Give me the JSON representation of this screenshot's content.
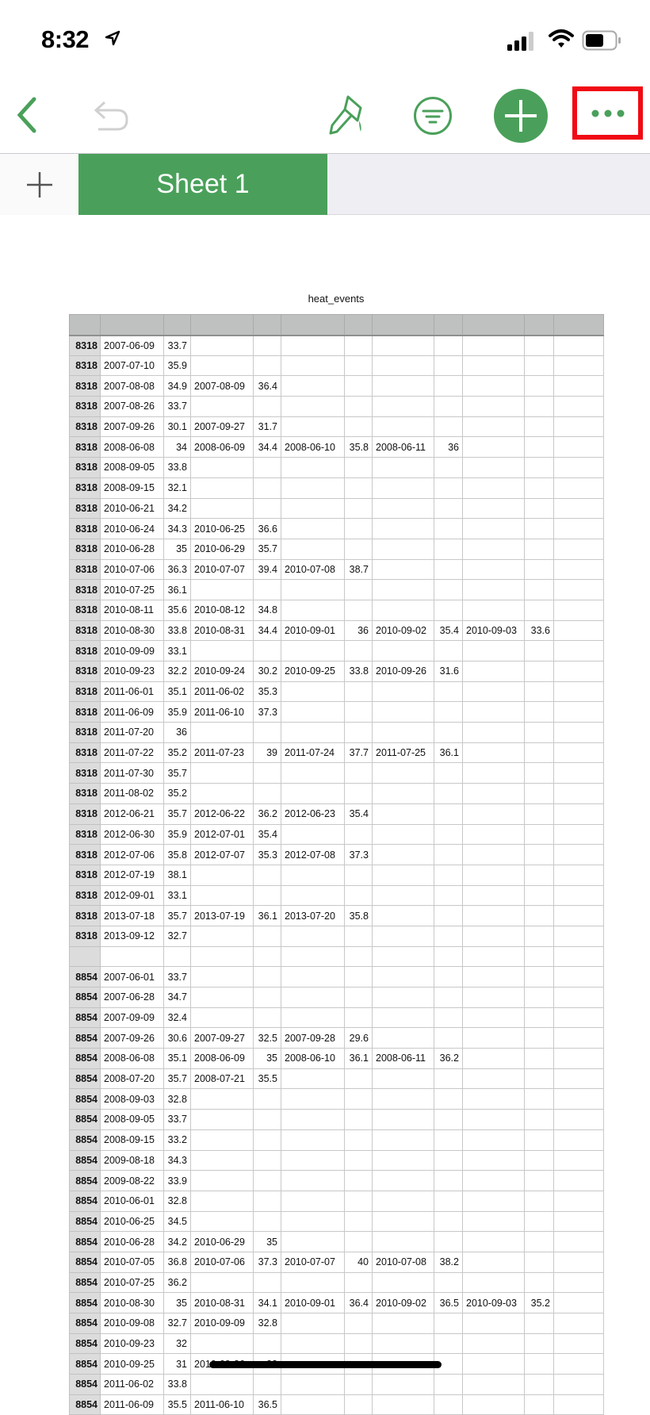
{
  "status_bar": {
    "time": "8:32",
    "icons": [
      "location-arrow-icon",
      "cellular-signal-icon",
      "wifi-icon",
      "battery-icon"
    ]
  },
  "toolbar": {
    "icons": [
      "back-chevron-icon",
      "undo-icon",
      "paintbrush-icon",
      "filter-icon",
      "add-icon",
      "more-icon"
    ],
    "accent": "#4aa05a",
    "highlight": "#f10a14"
  },
  "tabs": {
    "add_icon": "plus-icon",
    "sheets": [
      {
        "label": "Sheet 1",
        "active": true
      }
    ]
  },
  "table": {
    "title": "heat_events",
    "rows": [
      [
        "8318",
        "2007-06-09",
        "33.7"
      ],
      [
        "8318",
        "2007-07-10",
        "35.9"
      ],
      [
        "8318",
        "2007-08-08",
        "34.9",
        "2007-08-09",
        "36.4"
      ],
      [
        "8318",
        "2007-08-26",
        "33.7"
      ],
      [
        "8318",
        "2007-09-26",
        "30.1",
        "2007-09-27",
        "31.7"
      ],
      [
        "8318",
        "2008-06-08",
        "34",
        "2008-06-09",
        "34.4",
        "2008-06-10",
        "35.8",
        "2008-06-11",
        "36"
      ],
      [
        "8318",
        "2008-09-05",
        "33.8"
      ],
      [
        "8318",
        "2008-09-15",
        "32.1"
      ],
      [
        "8318",
        "2010-06-21",
        "34.2"
      ],
      [
        "8318",
        "2010-06-24",
        "34.3",
        "2010-06-25",
        "36.6"
      ],
      [
        "8318",
        "2010-06-28",
        "35",
        "2010-06-29",
        "35.7"
      ],
      [
        "8318",
        "2010-07-06",
        "36.3",
        "2010-07-07",
        "39.4",
        "2010-07-08",
        "38.7"
      ],
      [
        "8318",
        "2010-07-25",
        "36.1"
      ],
      [
        "8318",
        "2010-08-11",
        "35.6",
        "2010-08-12",
        "34.8"
      ],
      [
        "8318",
        "2010-08-30",
        "33.8",
        "2010-08-31",
        "34.4",
        "2010-09-01",
        "36",
        "2010-09-02",
        "35.4",
        "2010-09-03",
        "33.6"
      ],
      [
        "8318",
        "2010-09-09",
        "33.1"
      ],
      [
        "8318",
        "2010-09-23",
        "32.2",
        "2010-09-24",
        "30.2",
        "2010-09-25",
        "33.8",
        "2010-09-26",
        "31.6"
      ],
      [
        "8318",
        "2011-06-01",
        "35.1",
        "2011-06-02",
        "35.3"
      ],
      [
        "8318",
        "2011-06-09",
        "35.9",
        "2011-06-10",
        "37.3"
      ],
      [
        "8318",
        "2011-07-20",
        "36"
      ],
      [
        "8318",
        "2011-07-22",
        "35.2",
        "2011-07-23",
        "39",
        "2011-07-24",
        "37.7",
        "2011-07-25",
        "36.1"
      ],
      [
        "8318",
        "2011-07-30",
        "35.7"
      ],
      [
        "8318",
        "2011-08-02",
        "35.2"
      ],
      [
        "8318",
        "2012-06-21",
        "35.7",
        "2012-06-22",
        "36.2",
        "2012-06-23",
        "35.4"
      ],
      [
        "8318",
        "2012-06-30",
        "35.9",
        "2012-07-01",
        "35.4"
      ],
      [
        "8318",
        "2012-07-06",
        "35.8",
        "2012-07-07",
        "35.3",
        "2012-07-08",
        "37.3"
      ],
      [
        "8318",
        "2012-07-19",
        "38.1"
      ],
      [
        "8318",
        "2012-09-01",
        "33.1"
      ],
      [
        "8318",
        "2013-07-18",
        "35.7",
        "2013-07-19",
        "36.1",
        "2013-07-20",
        "35.8"
      ],
      [
        "8318",
        "2013-09-12",
        "32.7"
      ],
      [],
      [
        "8854",
        "2007-06-01",
        "33.7"
      ],
      [
        "8854",
        "2007-06-28",
        "34.7"
      ],
      [
        "8854",
        "2007-09-09",
        "32.4"
      ],
      [
        "8854",
        "2007-09-26",
        "30.6",
        "2007-09-27",
        "32.5",
        "2007-09-28",
        "29.6"
      ],
      [
        "8854",
        "2008-06-08",
        "35.1",
        "2008-06-09",
        "35",
        "2008-06-10",
        "36.1",
        "2008-06-11",
        "36.2"
      ],
      [
        "8854",
        "2008-07-20",
        "35.7",
        "2008-07-21",
        "35.5"
      ],
      [
        "8854",
        "2008-09-03",
        "32.8"
      ],
      [
        "8854",
        "2008-09-05",
        "33.7"
      ],
      [
        "8854",
        "2008-09-15",
        "33.2"
      ],
      [
        "8854",
        "2009-08-18",
        "34.3"
      ],
      [
        "8854",
        "2009-08-22",
        "33.9"
      ],
      [
        "8854",
        "2010-06-01",
        "32.8"
      ],
      [
        "8854",
        "2010-06-25",
        "34.5"
      ],
      [
        "8854",
        "2010-06-28",
        "34.2",
        "2010-06-29",
        "35"
      ],
      [
        "8854",
        "2010-07-05",
        "36.8",
        "2010-07-06",
        "37.3",
        "2010-07-07",
        "40",
        "2010-07-08",
        "38.2"
      ],
      [
        "8854",
        "2010-07-25",
        "36.2"
      ],
      [
        "8854",
        "2010-08-30",
        "35",
        "2010-08-31",
        "34.1",
        "2010-09-01",
        "36.4",
        "2010-09-02",
        "36.5",
        "2010-09-03",
        "35.2"
      ],
      [
        "8854",
        "2010-09-08",
        "32.7",
        "2010-09-09",
        "32.8"
      ],
      [
        "8854",
        "2010-09-23",
        "32"
      ],
      [
        "8854",
        "2010-09-25",
        "31",
        "2010-09-26",
        "32"
      ],
      [
        "8854",
        "2011-06-02",
        "33.8"
      ],
      [
        "8854",
        "2011-06-09",
        "35.5",
        "2011-06-10",
        "36.5"
      ]
    ]
  }
}
